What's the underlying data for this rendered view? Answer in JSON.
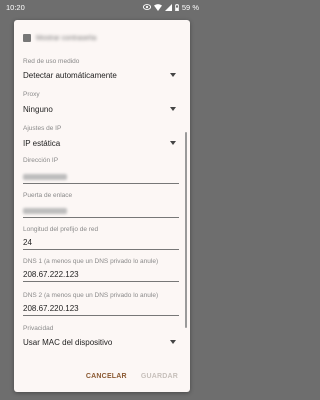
{
  "status_bar": {
    "time": "10:20",
    "battery_text": "59 %"
  },
  "dialog": {
    "show_password_label": "Mostrar contraseña",
    "metered": {
      "label": "Red de uso medido",
      "value": "Detectar automáticamente"
    },
    "proxy": {
      "label": "Proxy",
      "value": "Ninguno"
    },
    "ip_settings": {
      "label": "Ajustes de IP",
      "value": "IP estática"
    },
    "ip_address": {
      "label": "Dirección IP"
    },
    "gateway": {
      "label": "Puerta de enlace"
    },
    "prefix_length": {
      "label": "Longitud del prefijo de red",
      "value": "24"
    },
    "dns1": {
      "label": "DNS 1 (a menos que un DNS privado lo anule)",
      "value": "208.67.222.123"
    },
    "dns2": {
      "label": "DNS 2 (a menos que un DNS privado lo anule)",
      "value": "208.67.220.123"
    },
    "privacy": {
      "label": "Privacidad",
      "value": "Usar MAC del dispositivo"
    },
    "cancel_label": "CANCELAR",
    "save_label": "GUARDAR"
  }
}
